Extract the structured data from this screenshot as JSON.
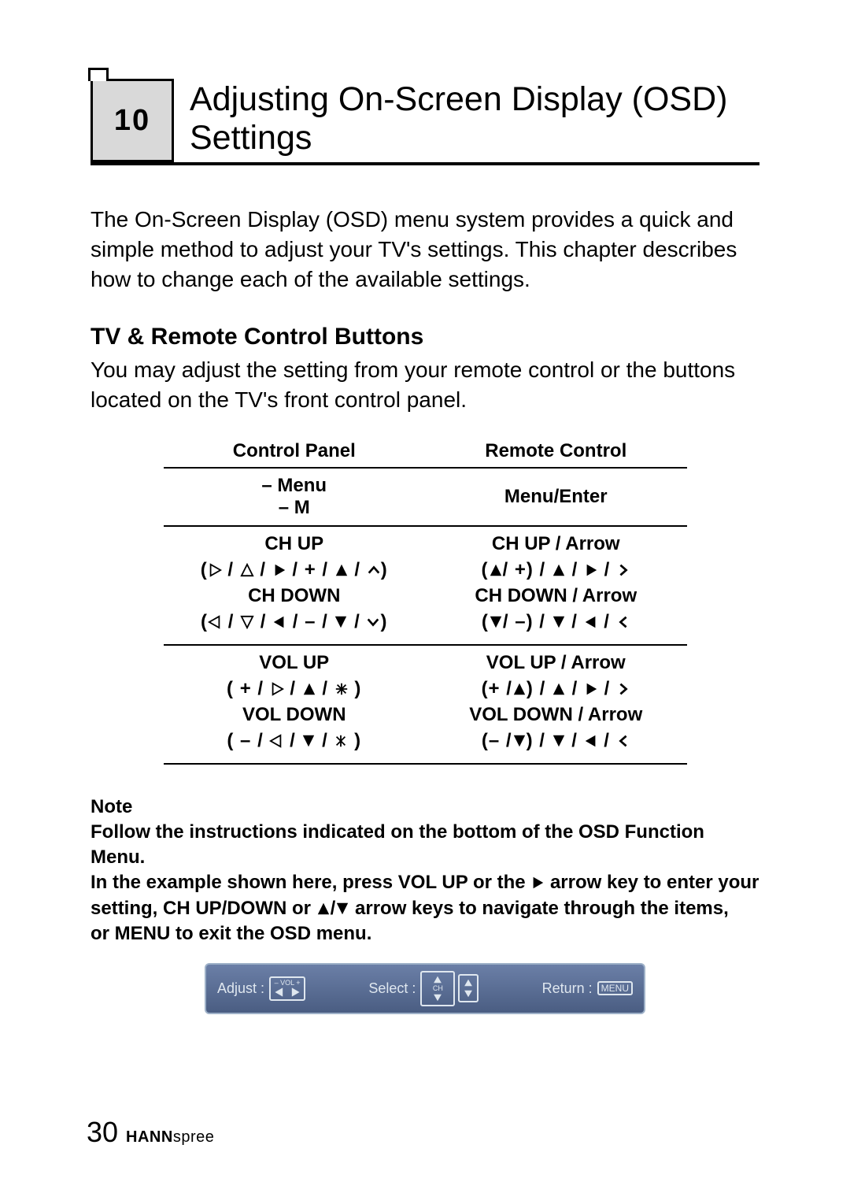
{
  "chapter": {
    "number": "10",
    "title": "Adjusting On-Screen Display (OSD) Settings"
  },
  "intro": "The On-Screen Display (OSD) menu system provides a quick and simple method to adjust your TV's settings. This chapter describes how to change each of the available settings.",
  "section": {
    "heading": "TV & Remote Control Buttons",
    "body": "You may adjust the setting from your remote control or the buttons located on the TV's front control panel."
  },
  "table": {
    "col1": "Control Panel",
    "col2": "Remote Control",
    "row_menu": {
      "cp_line1": "– Menu",
      "cp_line2": "– M",
      "rc": "Menu/Enter"
    },
    "row_ch": {
      "cp_up": "CH UP",
      "cp_down": "CH DOWN",
      "rc_up": "CH UP / Arrow",
      "rc_down": "CH DOWN / Arrow"
    },
    "row_vol": {
      "cp_up": "VOL UP",
      "cp_down": "VOL DOWN",
      "rc_up": "VOL UP / Arrow",
      "rc_down": "VOL DOWN / Arrow"
    }
  },
  "note": {
    "label": "Note",
    "line1": "Follow the instructions indicated on the bottom of the OSD Function Menu.",
    "line2a": "In the example shown here, press VOL UP or the ",
    "line2b": " arrow key to enter your",
    "line3a": "setting, CH UP/DOWN or ",
    "line3b": " arrow keys to navigate through the items,",
    "line4": "or MENU to exit the OSD menu."
  },
  "osd": {
    "adjust_label": "Adjust :",
    "adjust_chip_top": "– VOL +",
    "select_label": "Select :",
    "select_chip": "CH",
    "return_label": "Return :",
    "return_chip": "MENU"
  },
  "footer": {
    "page": "30",
    "brand_bold": "HANN",
    "brand_rest": "spree"
  }
}
